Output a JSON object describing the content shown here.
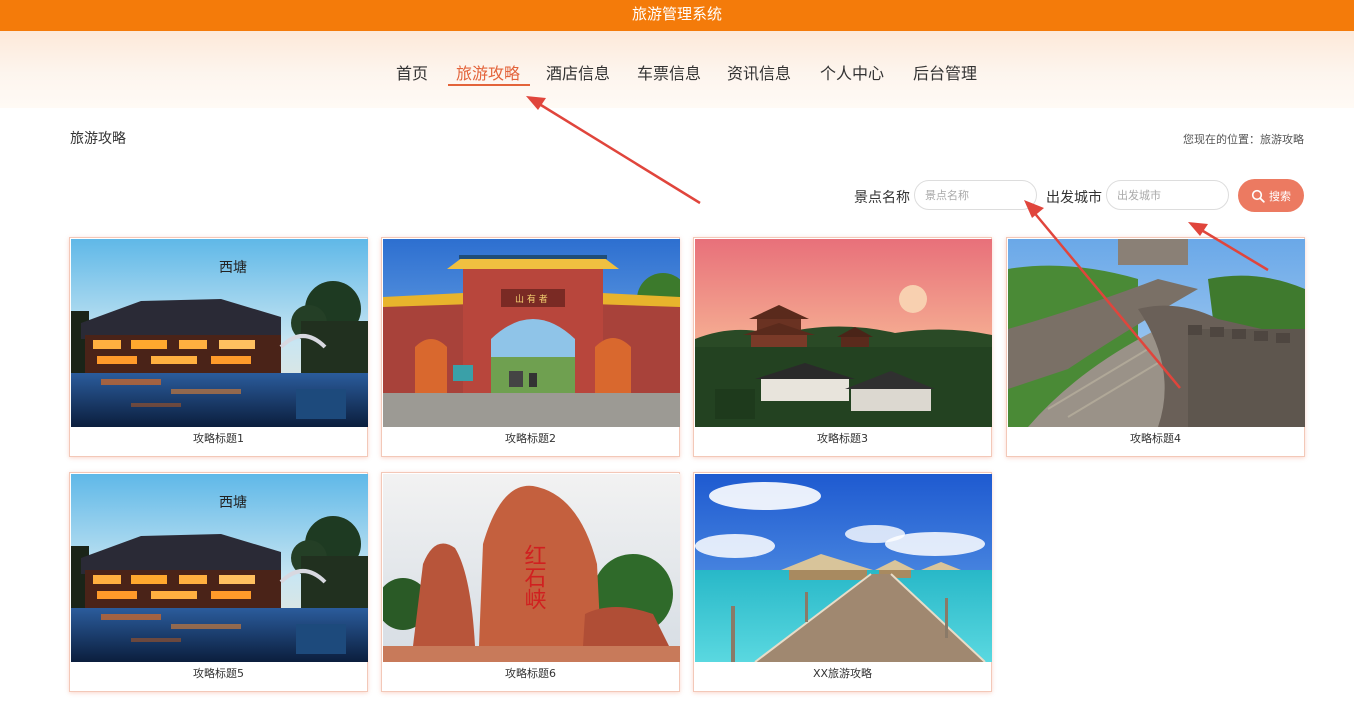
{
  "header": {
    "title": "旅游管理系统"
  },
  "nav": {
    "items": [
      {
        "label": "首页"
      },
      {
        "label": "旅游攻略"
      },
      {
        "label": "酒店信息"
      },
      {
        "label": "车票信息"
      },
      {
        "label": "资讯信息"
      },
      {
        "label": "个人中心"
      },
      {
        "label": "后台管理"
      }
    ],
    "active": "旅游攻略"
  },
  "page": {
    "title": "旅游攻略",
    "breadcrumb": "您现在的位置：旅游攻略"
  },
  "search": {
    "spot_label": "景点名称",
    "spot_placeholder": "景点名称",
    "spot_value": "",
    "city_label": "出发城市",
    "city_placeholder": "出发城市",
    "city_value": "",
    "button_label": "搜索"
  },
  "cards": [
    {
      "title": "攻略标题1",
      "image": "water-town-night"
    },
    {
      "title": "攻略标题2",
      "image": "red-gate"
    },
    {
      "title": "攻略标题3",
      "image": "pagoda-sunset"
    },
    {
      "title": "攻略标题4",
      "image": "great-wall"
    },
    {
      "title": "攻略标题5",
      "image": "water-town-night"
    },
    {
      "title": "攻略标题6",
      "image": "red-rock"
    },
    {
      "title": "XX旅游攻略",
      "image": "beach-pier"
    }
  ],
  "image_text": {
    "water_town_calligraphy": "西塘",
    "gate_plaque": "山 有 者",
    "rock_inscription": "红石峡"
  },
  "colors": {
    "topbar": "#f47b0a",
    "accent": "#e3633a",
    "search_button": "#ec7a61",
    "annotation_arrow": "#e0453c"
  }
}
